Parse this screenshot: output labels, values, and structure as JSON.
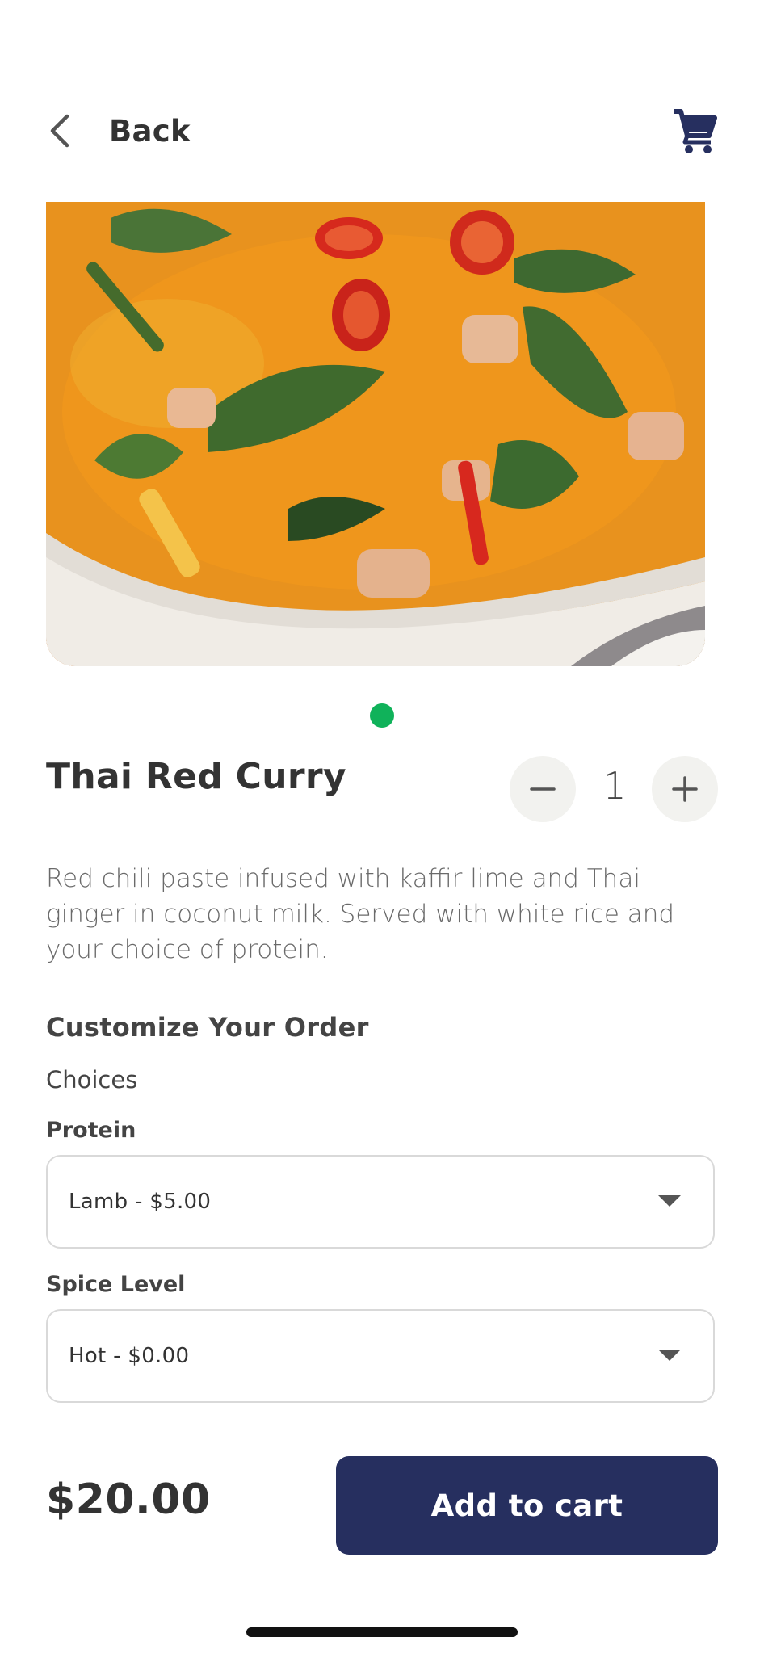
{
  "header": {
    "back_label": "Back",
    "back_icon": "chevron-left-icon",
    "cart_icon": "shopping-cart-icon"
  },
  "product": {
    "image_alt": "Thai Red Curry photo",
    "carousel_active_color": "#10b25a",
    "title": "Thai Red Curry",
    "quantity": "1",
    "description": "Red chili paste infused with kaffir lime and Thai ginger in coconut milk. Served with white rice and your choice of protein."
  },
  "customize": {
    "section_title": "Customize Your Order",
    "choices_label": "Choices",
    "protein": {
      "label": "Protein",
      "value": "Lamb - $5.00"
    },
    "spice": {
      "label": "Spice Level",
      "value": "Hot - $0.00"
    }
  },
  "footer": {
    "price": "$20.00",
    "add_to_cart_label": "Add to cart",
    "button_color": "#262f5f"
  }
}
